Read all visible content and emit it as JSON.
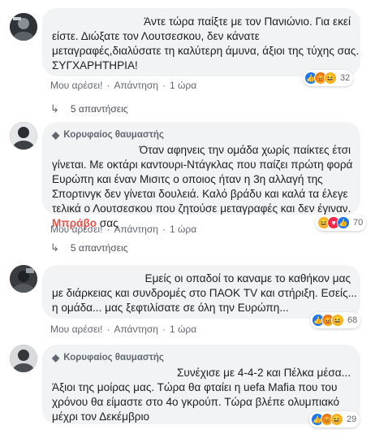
{
  "comments": [
    {
      "badge": "",
      "lines": [
        "Άντε τώρα παίξτε με τον Πανιώνιο. Για εκεί",
        "είστε. Διώξατε τον Λουτσεσκου, δεν κάνατε",
        "μεταγραφές,διαλύσατε τη καλύτερη άμυνα, άξιοι της τύχης σας.",
        "ΣΥΓΧΑΡΗΤΗΡΙΑ!"
      ],
      "reaction_count": "32",
      "reactions": [
        "like-icon",
        "angry-icon",
        "haha-icon"
      ],
      "like": "Μου αρέσει!",
      "reply": "Απάντηση",
      "time": "1 ώρα",
      "replies": "5 απαντήσεις"
    },
    {
      "badge": "Κορυφαίος θαυμαστής",
      "lines": [
        "Όταν αφηνεις την ομάδα χωρίς παίκτες έτσι",
        "γίνεται. Με οκτάρι καντουρι-Ντάγκλας που παίζει πρώτη φορά",
        "Ευρώπη και έναν Μισιτς ο οποιος ήταν η 3η αλλαγή της",
        "Σπορτινγκ δεν γίνεται δουλειά. Καλό βράδυ και καλά τα έλεγε",
        "τελικά ο Λουτσεσκου που ζητούσε μεταγραφές και δεν έγιναν."
      ],
      "link_word": "Μπράβο",
      "link_tail": " σας",
      "reaction_count": "70",
      "reactions": [
        "haha-icon",
        "love-icon",
        "like-icon"
      ],
      "like": "Μου αρέσει!",
      "reply": "Απάντηση",
      "time": "1 ώρα",
      "replies": "5 απαντήσεις"
    },
    {
      "badge": "",
      "lines": [
        "Εμείς οι οπαδοί το καναμε το καθήκον μας",
        "με διάρκειας και συνδρομές στο ΠΑΟΚ TV και στήριξη. Εσείς...",
        "η ομάδα... μας ξεφτιλίσατε σε όλη την Ευρώπη..."
      ],
      "reaction_count": "68",
      "reactions": [
        "like-icon",
        "angry-icon",
        "haha-icon"
      ],
      "like": "Μου αρέσει!",
      "reply": "Απάντηση",
      "time": "1 ώρα"
    },
    {
      "badge": "Κορυφαίος θαυμαστής",
      "lines": [
        "Συνέχισε με 4-4-2 και Πέλκα μέσα...",
        "Άξιοι της μοίρας μας. Τώρα θα φταίει η uefa Mafia που του",
        "χρόνου θα είμαστε στο 4ο γκρούπ. Τώρα βλέπε ολυμπιακό",
        "μέχρι τον Δεκέμβριο"
      ],
      "reaction_count": "29",
      "reactions": [
        "like-icon",
        "angry-icon",
        "haha-icon"
      ]
    }
  ]
}
